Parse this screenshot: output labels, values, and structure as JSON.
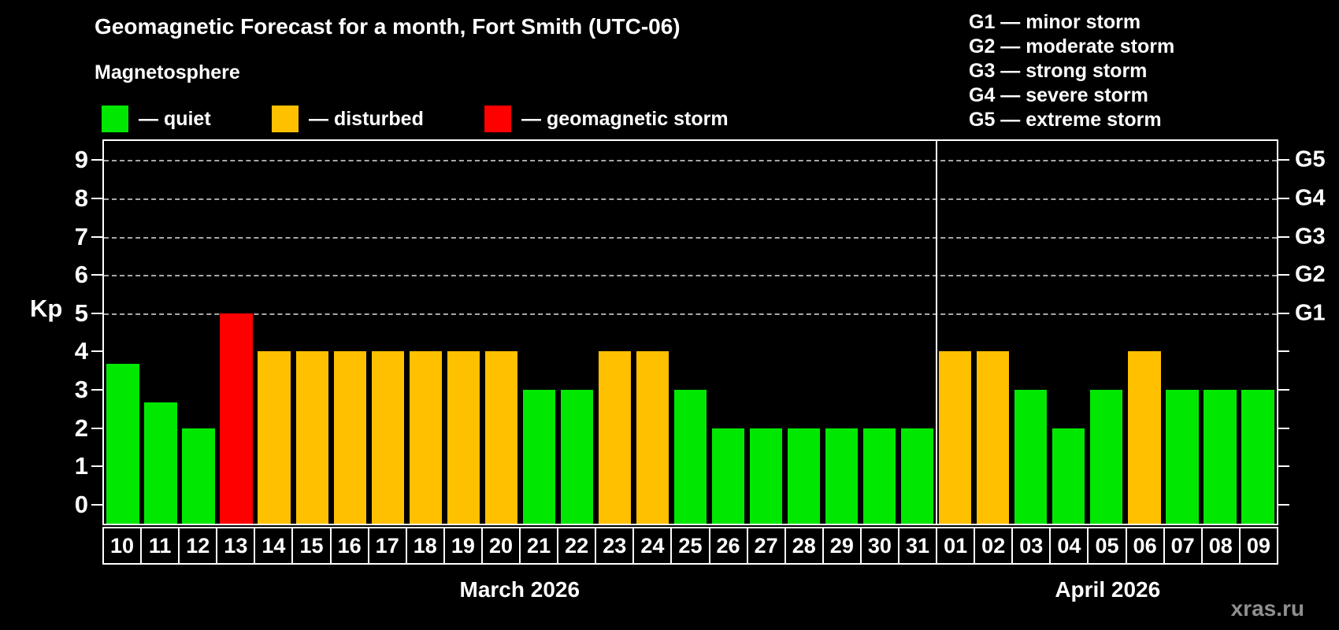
{
  "header": {
    "title": "Geomagnetic Forecast for a month, Fort Smith (UTC-06)",
    "subtitle": "Magnetosphere"
  },
  "legend": [
    {
      "status": "quiet",
      "label": "— quiet"
    },
    {
      "status": "disturbed",
      "label": "— disturbed"
    },
    {
      "status": "storm",
      "label": "— geomagnetic storm"
    }
  ],
  "g_legend": [
    "G1 — minor storm",
    "G2 — moderate storm",
    "G3 — strong storm",
    "G4 — severe storm",
    "G5 — extreme storm"
  ],
  "status_colors": {
    "quiet": "#00e800",
    "disturbed": "#ffc000",
    "storm": "#ff0000"
  },
  "watermark": "xras.ru",
  "chart_data": {
    "type": "bar",
    "title": "Geomagnetic Forecast for a month, Fort Smith (UTC-06)",
    "ylabel": "Kp",
    "ylim": [
      -0.5,
      9.5
    ],
    "yticks": [
      0,
      1,
      2,
      3,
      4,
      5,
      6,
      7,
      8,
      9
    ],
    "grid_levels": [
      5,
      6,
      7,
      8,
      9
    ],
    "grid": true,
    "legend_position": "top",
    "g_scale": [
      {
        "label": "G1",
        "kp": 5
      },
      {
        "label": "G2",
        "kp": 6
      },
      {
        "label": "G3",
        "kp": 7
      },
      {
        "label": "G4",
        "kp": 8
      },
      {
        "label": "G5",
        "kp": 9
      }
    ],
    "months": [
      {
        "label": "March 2026",
        "bars": [
          {
            "day": "10",
            "kp": 3.67,
            "status": "quiet"
          },
          {
            "day": "11",
            "kp": 2.67,
            "status": "quiet"
          },
          {
            "day": "12",
            "kp": 2,
            "status": "quiet"
          },
          {
            "day": "13",
            "kp": 5,
            "status": "storm"
          },
          {
            "day": "14",
            "kp": 4,
            "status": "disturbed"
          },
          {
            "day": "15",
            "kp": 4,
            "status": "disturbed"
          },
          {
            "day": "16",
            "kp": 4,
            "status": "disturbed"
          },
          {
            "day": "17",
            "kp": 4,
            "status": "disturbed"
          },
          {
            "day": "18",
            "kp": 4,
            "status": "disturbed"
          },
          {
            "day": "19",
            "kp": 4,
            "status": "disturbed"
          },
          {
            "day": "20",
            "kp": 4,
            "status": "disturbed"
          },
          {
            "day": "21",
            "kp": 3,
            "status": "quiet"
          },
          {
            "day": "22",
            "kp": 3,
            "status": "quiet"
          },
          {
            "day": "23",
            "kp": 4,
            "status": "disturbed"
          },
          {
            "day": "24",
            "kp": 4,
            "status": "disturbed"
          },
          {
            "day": "25",
            "kp": 3,
            "status": "quiet"
          },
          {
            "day": "26",
            "kp": 2,
            "status": "quiet"
          },
          {
            "day": "27",
            "kp": 2,
            "status": "quiet"
          },
          {
            "day": "28",
            "kp": 2,
            "status": "quiet"
          },
          {
            "day": "29",
            "kp": 2,
            "status": "quiet"
          },
          {
            "day": "30",
            "kp": 2,
            "status": "quiet"
          },
          {
            "day": "31",
            "kp": 2,
            "status": "quiet"
          }
        ]
      },
      {
        "label": "April 2026",
        "bars": [
          {
            "day": "01",
            "kp": 4,
            "status": "disturbed"
          },
          {
            "day": "02",
            "kp": 4,
            "status": "disturbed"
          },
          {
            "day": "03",
            "kp": 3,
            "status": "quiet"
          },
          {
            "day": "04",
            "kp": 2,
            "status": "quiet"
          },
          {
            "day": "05",
            "kp": 3,
            "status": "quiet"
          },
          {
            "day": "06",
            "kp": 4,
            "status": "disturbed"
          },
          {
            "day": "07",
            "kp": 3,
            "status": "quiet"
          },
          {
            "day": "08",
            "kp": 3,
            "status": "quiet"
          },
          {
            "day": "09",
            "kp": 3,
            "status": "quiet"
          }
        ]
      }
    ]
  }
}
